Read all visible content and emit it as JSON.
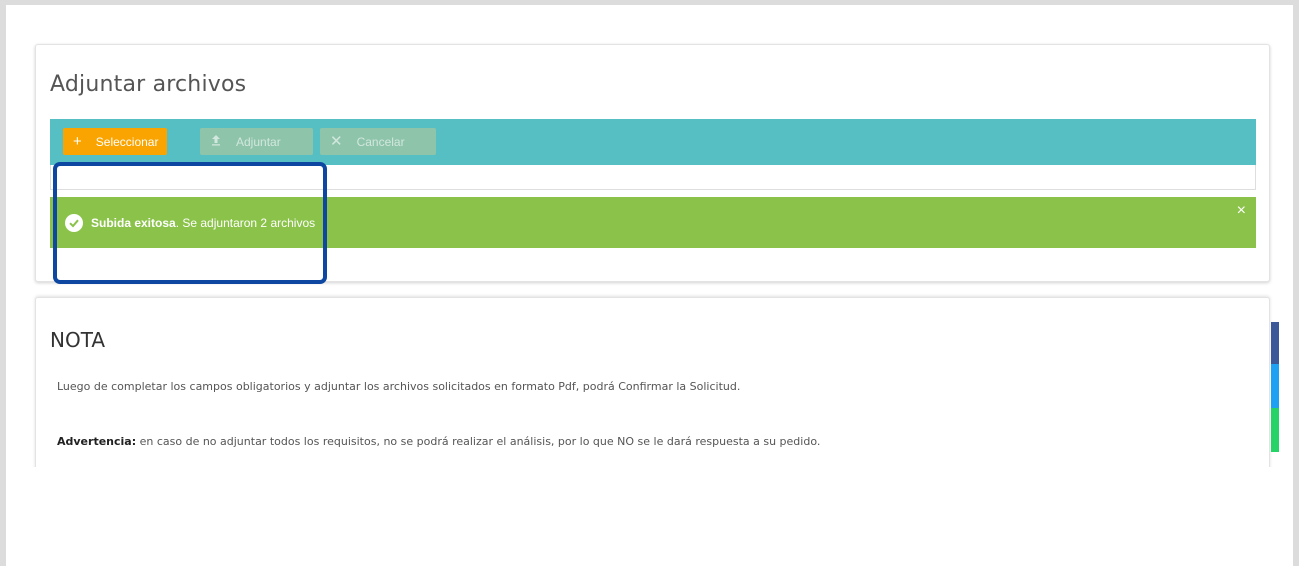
{
  "upload": {
    "title": "Adjuntar archivos",
    "buttons": {
      "select": "Seleccionar",
      "upload": "Adjuntar",
      "cancel": "Cancelar"
    },
    "alert": {
      "strong": "Subida exitosa",
      "message": ". Se adjuntaron 2 archivos",
      "close": "×"
    }
  },
  "note": {
    "title": "NOTA",
    "line1": "Luego de completar los campos obligatorios y adjuntar los archivos solicitados en formato Pdf, podrá Confirmar la Solicitud.",
    "warning_label": "Advertencia:",
    "warning_text": " en caso de no adjuntar todos los requisitos, no se podrá realizar el análisis, por lo que NO se le dará respuesta a su pedido."
  },
  "colors": {
    "toolbar": "#56bfc3",
    "select_button": "#f9a400",
    "alert_success": "#8bc34a",
    "highlight_border": "#0d47a1"
  },
  "icons": [
    "plus-icon",
    "upload-icon",
    "close-icon",
    "check-circle-icon"
  ]
}
